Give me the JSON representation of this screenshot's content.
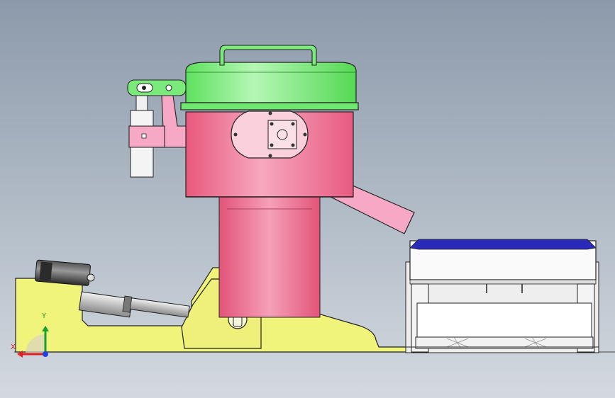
{
  "triad": {
    "x_label": "X",
    "y_label": "Y"
  },
  "colors": {
    "background_top": "#8d9aab",
    "background_bottom": "#d3d9df",
    "lid": "#6ee86e",
    "chamber": "#f07898",
    "base": "#f0f47a",
    "tray_trim": "#2a2ab8",
    "actuator": "#3a3a3a"
  }
}
